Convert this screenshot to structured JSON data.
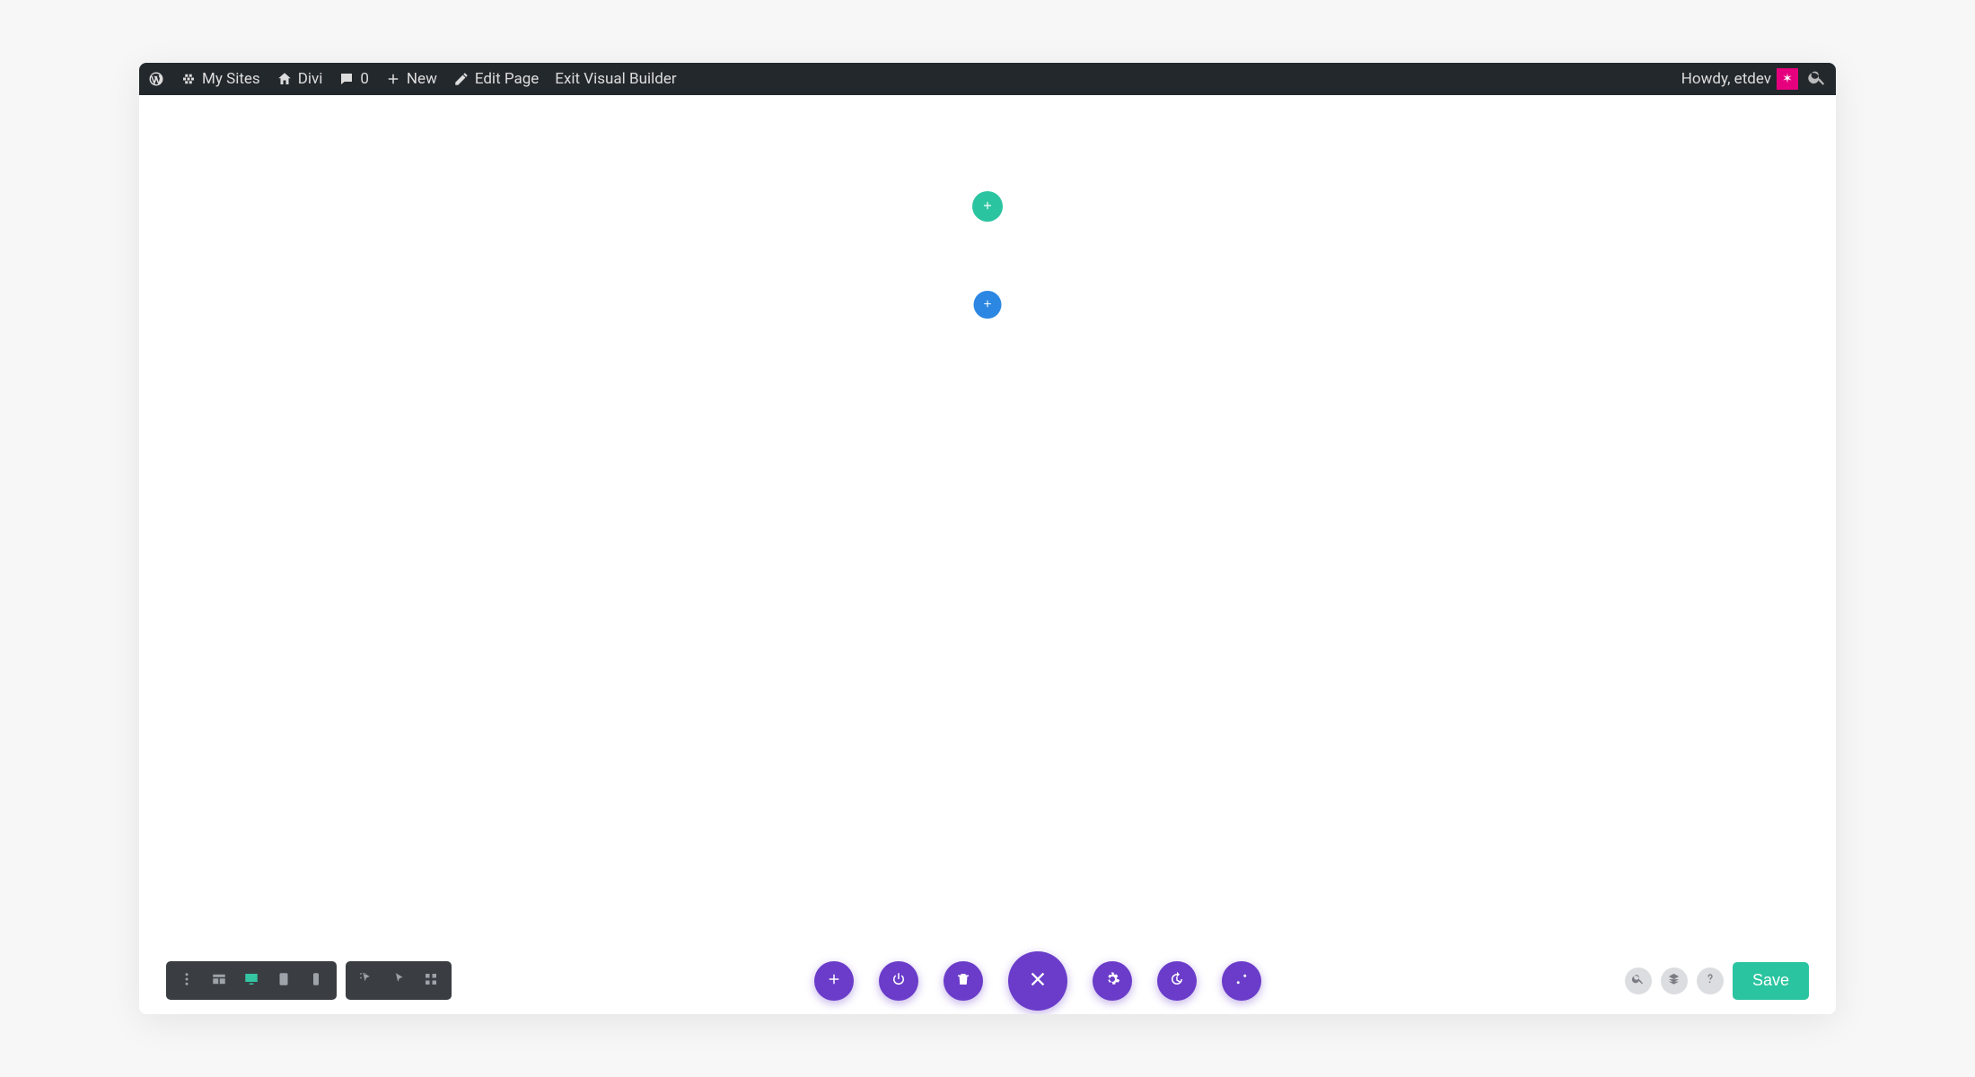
{
  "admin_bar": {
    "my_sites": "My Sites",
    "site_name": "Divi",
    "comments_count": "0",
    "new": "New",
    "edit_page": "Edit Page",
    "exit_builder": "Exit Visual Builder",
    "howdy": "Howdy, etdev"
  },
  "section_toolbar": {
    "icons": [
      "move",
      "settings",
      "duplicate",
      "power",
      "delete",
      "close",
      "more"
    ]
  },
  "canvas": {
    "add_row_label": "+",
    "add_section_label": "+"
  },
  "dock": {
    "group1": [
      "more",
      "wireframe",
      "desktop",
      "tablet",
      "phone"
    ],
    "group2": [
      "click-mode",
      "grid-mode",
      "grid-thick"
    ],
    "purple": [
      "add",
      "power",
      "delete",
      "close-big",
      "settings",
      "history",
      "sliders"
    ],
    "help_icons": [
      "zoom",
      "layers",
      "help"
    ],
    "save_label": "Save"
  },
  "colors": {
    "blue": "#2b87e2",
    "teal": "#2bc4a0",
    "purple": "#6a3cc9",
    "dark": "#23282d"
  }
}
